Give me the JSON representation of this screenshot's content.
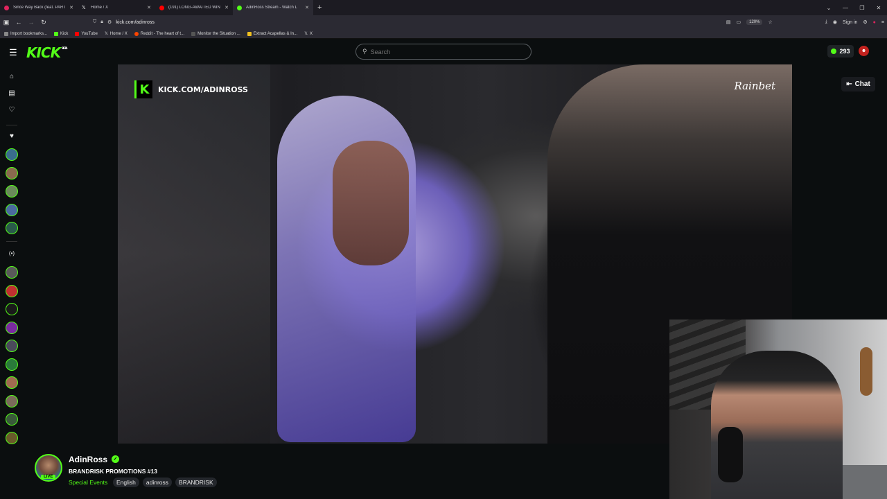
{
  "browser": {
    "tabs": [
      {
        "title": "Since Way Back (feat. PART",
        "color": "#e0245e"
      },
      {
        "title": "Home / X",
        "color": "#ffffff"
      },
      {
        "title": "(191) LONG-AWAITED WIN | Dr",
        "color": "#ff0000"
      },
      {
        "title": "AdinRoss Stream - Watch L",
        "color": "#53fc18"
      }
    ],
    "url": "kick.com/adinross",
    "zoom": "120%",
    "sign_in": "Sign in",
    "bookmarks": [
      "Import bookmarks...",
      "Kick",
      "YouTube",
      "Home / X",
      "Reddit - The heart of t...",
      "Monitor the Situation ...",
      "Extract Acapellas & In...",
      "X"
    ]
  },
  "header": {
    "logo": "KICK",
    "logo_badge": "BETA",
    "search_placeholder": "Search",
    "kicks_count": "293"
  },
  "video": {
    "watermark": "KICK.COM/ADINROSS",
    "sponsor": "Rainbet"
  },
  "chat_button": "Chat",
  "channel": {
    "name": "AdinRoss",
    "live_badge": "LIVE",
    "title": "BRANDRISK PROMOTIONS #13",
    "category": "Special Events",
    "tags": [
      "English",
      "adinross",
      "BRANDRISK"
    ]
  },
  "colors": {
    "accent": "#53fc18",
    "background": "#0b0e0f"
  }
}
